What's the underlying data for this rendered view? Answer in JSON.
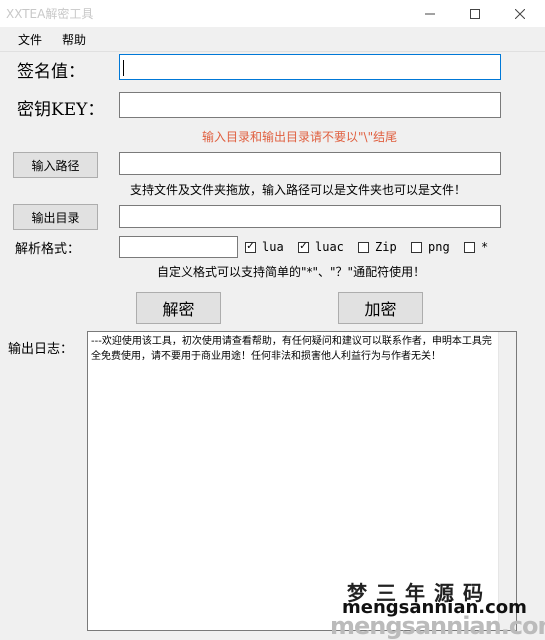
{
  "window": {
    "title": "XXTEA解密工具"
  },
  "menu": {
    "file": "文件",
    "help": "帮助"
  },
  "fields": {
    "signature_label": "签名值：",
    "signature_value": "",
    "key_label": "密钥KEY：",
    "key_value": "",
    "dir_hint": "输入目录和输出目录请不要以\"\\\"结尾",
    "input_path_button": "输入路径",
    "input_path_value": "",
    "drag_hint": "支持文件及文件夹拖放，输入路径可以是文件夹也可以是文件！",
    "output_dir_button": "输出目录",
    "output_dir_value": "",
    "format_label": "解析格式：",
    "format_value": "",
    "format_hint": "自定义格式可以支持简单的\"*\"、\"？\"通配符使用！"
  },
  "formats": [
    {
      "label": "lua",
      "checked": true
    },
    {
      "label": "luac",
      "checked": true
    },
    {
      "label": "Zip",
      "checked": false
    },
    {
      "label": "png",
      "checked": false
    },
    {
      "label": "*",
      "checked": false
    }
  ],
  "actions": {
    "decrypt": "解密",
    "encrypt": "加密"
  },
  "log": {
    "label": "输出日志：",
    "text": "---欢迎使用该工具，初次使用请查看帮助，有任何疑问和建议可以联系作者，申明本工具完全免费使用，请不要用于商业用途！任何非法和损害他人利益行为与作者无关！"
  },
  "watermark": {
    "cn": "梦三年源码",
    "url": "mengsannian.com",
    "url_faded": "mengsannian.com"
  }
}
